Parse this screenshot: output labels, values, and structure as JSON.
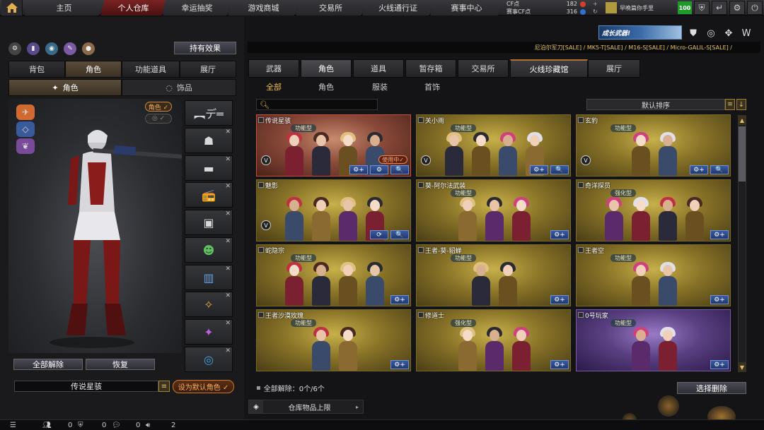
{
  "nav": {
    "tabs": [
      "主页",
      "个人仓库",
      "幸运抽奖",
      "游戏商城",
      "交易所",
      "火线通行证",
      "赛事中心"
    ],
    "active_tab": 1
  },
  "currency": {
    "cf_label": "CF点",
    "cf_value": "182",
    "match_label": "赛事CF点",
    "match_value": "316"
  },
  "profile": {
    "name": "早晚篇你手里",
    "level": "100"
  },
  "left": {
    "hold_effect": "持有效果",
    "tabs": [
      "背包",
      "角色",
      "功能道具",
      "展厅"
    ],
    "active_tab": 1,
    "subtabs": [
      "角色",
      "饰品"
    ],
    "active_subtab": 0,
    "role_tag": "角色 ✓",
    "unequip_all": "全部解除",
    "restore": "恢复",
    "character_name": "传说星骇",
    "set_default": "设为默认角色 ✓"
  },
  "right": {
    "ticker": "尼泊尔军刀[SALE] / MK5-T[SALE] / M16-S[SALE] / Micro-GALIL-S[SALE] /",
    "banner": "成长武器!",
    "tabs": [
      "武器",
      "角色",
      "道具",
      "暂存箱",
      "交易所",
      "火线珍藏馆",
      "展厅"
    ],
    "active_tab": 1,
    "highlight_tab": 5,
    "subtabs": [
      "全部",
      "角色",
      "服装",
      "首饰"
    ],
    "active_subtab": 0,
    "sort_label": "默认排序",
    "unequip_count": "全部解除：0个/6个",
    "select_delete": "选择删除",
    "storage_limit": "仓库物品上限"
  },
  "cards": [
    {
      "title": "传说星骇",
      "badge": "功能型",
      "figures": 4,
      "in_use": "使用中✓",
      "selected": true,
      "style": "red",
      "acts": [
        "⚙+",
        "⚙",
        "🔍"
      ],
      "vmark": true
    },
    {
      "title": "关小雨",
      "badge": "功能型",
      "figures": 4,
      "in_use": "",
      "selected": false,
      "style": "gold",
      "acts": [
        "⚙+",
        "🔍"
      ],
      "vmark": true
    },
    {
      "title": "玄豹",
      "badge": "功能型",
      "figures": 2,
      "in_use": "",
      "selected": false,
      "style": "gold",
      "acts": [
        "⚙+",
        "🔍"
      ],
      "vmark": true
    },
    {
      "title": "魅影",
      "badge": "",
      "figures": 4,
      "in_use": "",
      "selected": false,
      "style": "gold",
      "acts": [
        "⟳",
        "🔍"
      ],
      "vmark": true
    },
    {
      "title": "葵-阿尔法武装",
      "badge": "功能型",
      "figures": 3,
      "in_use": "",
      "selected": false,
      "style": "gold",
      "acts": [
        "⚙+"
      ],
      "vmark": false
    },
    {
      "title": "奇洋探员",
      "badge": "强化型",
      "figures": 4,
      "in_use": "",
      "selected": false,
      "style": "gold",
      "acts": [
        "⚙+"
      ],
      "vmark": false
    },
    {
      "title": "蛇隐宗",
      "badge": "功能型",
      "figures": 4,
      "in_use": "",
      "selected": false,
      "style": "gold",
      "acts": [
        "⚙+"
      ],
      "vmark": false
    },
    {
      "title": "王者-葵-貂蝉",
      "badge": "功能型",
      "figures": 2,
      "in_use": "",
      "selected": false,
      "style": "gold",
      "acts": [
        "⚙+"
      ],
      "vmark": false
    },
    {
      "title": "王者空",
      "badge": "功能型",
      "figures": 2,
      "in_use": "",
      "selected": false,
      "style": "gold",
      "acts": [
        "⚙+"
      ],
      "vmark": false
    },
    {
      "title": "王者沙漠玫瑰",
      "badge": "功能型",
      "figures": 2,
      "in_use": "",
      "selected": false,
      "style": "gold",
      "acts": [
        "⚙+"
      ],
      "vmark": false
    },
    {
      "title": "修道士",
      "badge": "强化型",
      "figures": 3,
      "in_use": "",
      "selected": false,
      "style": "gold",
      "acts": [
        "⚙+"
      ],
      "vmark": false
    },
    {
      "title": "0号玩家",
      "badge": "功能型",
      "figures": 2,
      "in_use": "",
      "selected": false,
      "style": "purple",
      "acts": [
        "⚙+"
      ],
      "vmark": false
    }
  ],
  "bottom": {
    "count1": "0",
    "count2": "0",
    "count3": "0",
    "count4": "2"
  }
}
